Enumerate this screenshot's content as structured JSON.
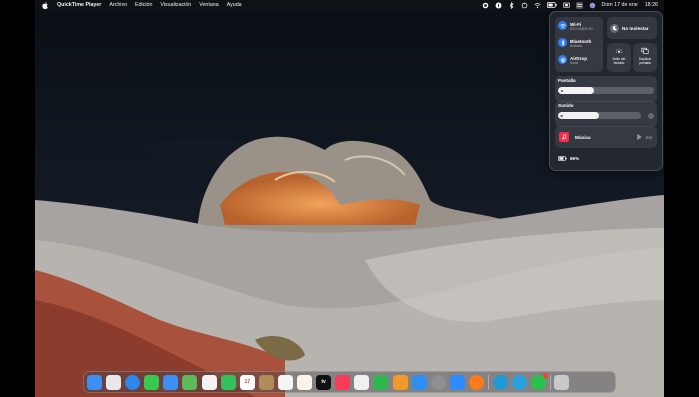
{
  "menubar": {
    "app_name": "QuickTime Player",
    "menus": [
      "Archivo",
      "Edición",
      "Visualización",
      "Ventana",
      "Ayuda"
    ],
    "date": "Dom 17 de ene",
    "time": "18:26"
  },
  "control_center": {
    "wifi": {
      "label": "Wi-Fi",
      "network": "ECO-GMDB-5G"
    },
    "bluetooth": {
      "label": "Bluetooth",
      "status": "Activado"
    },
    "airdrop": {
      "label": "AirDrop",
      "status": "Nadie"
    },
    "do_not_disturb": {
      "label": "No molestar"
    },
    "keyboard_brightness": {
      "label": "Brillo del teclado"
    },
    "screen_mirroring": {
      "label": "Duplicar pantalla"
    },
    "display": {
      "label": "Pantalla",
      "level_percent": 38
    },
    "sound": {
      "label": "Sonido",
      "level_percent": 49
    },
    "now_playing": {
      "label": "Música"
    },
    "battery": {
      "label": "66%"
    }
  },
  "dock": {
    "apps": [
      {
        "name": "Finder",
        "color": "#3d8ff2"
      },
      {
        "name": "Launchpad",
        "color": "#e8e8ea"
      },
      {
        "name": "Safari",
        "color": "#2d86e9"
      },
      {
        "name": "Mensajes",
        "color": "#3ac74f"
      },
      {
        "name": "Mail",
        "color": "#3f8ef5"
      },
      {
        "name": "Mapas",
        "color": "#5fb85a"
      },
      {
        "name": "Fotos",
        "color": "#f3f3f3"
      },
      {
        "name": "FaceTime",
        "color": "#35c05b"
      },
      {
        "name": "Calendario",
        "color": "#ffffff",
        "text": "17"
      },
      {
        "name": "Notas adhesivas",
        "color": "#b08b5a"
      },
      {
        "name": "Recordatorios",
        "color": "#f4f4f4"
      },
      {
        "name": "Notas",
        "color": "#f8f5e8"
      },
      {
        "name": "Apple TV",
        "color": "#111111",
        "text": "tv"
      },
      {
        "name": "Música",
        "color": "#f73c57"
      },
      {
        "name": "Keynote",
        "color": "#f0f0f0"
      },
      {
        "name": "Numbers",
        "color": "#2fb84f"
      },
      {
        "name": "Pages",
        "color": "#f19a2c"
      },
      {
        "name": "App Store",
        "color": "#2f8ef2"
      },
      {
        "name": "Preferencias del Sistema",
        "color": "#8e8e93"
      },
      {
        "name": "Zoom",
        "color": "#2d8cff"
      },
      {
        "name": "Firefox",
        "color": "#ff7a1a"
      },
      {
        "name": "Edge",
        "color": "#1f9ad6"
      },
      {
        "name": "Telegram",
        "color": "#2aa1e0"
      },
      {
        "name": "WhatsApp",
        "color": "#29c24a"
      },
      {
        "name": "Papelera",
        "color": "#c9c9cc"
      }
    ]
  }
}
